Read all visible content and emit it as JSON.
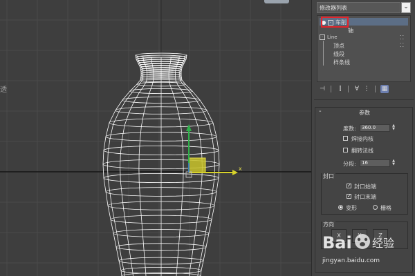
{
  "viewport": {
    "left_label": "透",
    "gizmo_axis_label": "x"
  },
  "panel": {
    "modifier_list": "修改器列表",
    "stack": {
      "selected_item": "车削",
      "axis_item": "轴",
      "line_item": "Line",
      "sub_items": [
        "顶点",
        "线段",
        "样条线"
      ]
    },
    "parameters": {
      "title": "参数",
      "degrees_label": "度数:",
      "degrees_value": "360.0",
      "weld_core_label": "焊接内核",
      "weld_core_checked": false,
      "flip_normals_label": "翻转法线",
      "flip_normals_checked": false,
      "segments_label": "分段:",
      "segments_value": "16",
      "capping": {
        "title": "封口",
        "cap_start_label": "封口始端",
        "cap_start_checked": true,
        "cap_end_label": "封口末端",
        "cap_end_checked": true,
        "morph_label": "变形",
        "grid_label": "栅格",
        "selected_option": "变形"
      },
      "direction": {
        "title": "方向",
        "buttons": [
          "X",
          "Y",
          "Z"
        ]
      }
    }
  },
  "watermark": {
    "brand": "Bai",
    "brand_cn": "经验",
    "url": "jingyan.baidu.com"
  },
  "colors": {
    "highlight_red": "#e3242b",
    "axis_x": "#d7d22a",
    "axis_y": "#2fb04a",
    "axis_z": "#3b6cd8",
    "mesh": "#ffffff"
  }
}
